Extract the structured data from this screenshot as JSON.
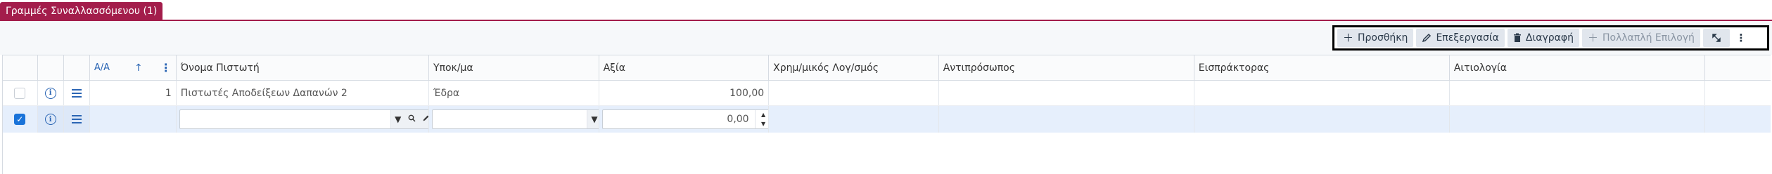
{
  "tab": {
    "label": "Γραμμές Συναλλασσόμενου (1)"
  },
  "toolbar": {
    "add": {
      "icon": "plus-icon",
      "label": "Προσθήκη"
    },
    "edit": {
      "icon": "pencil-icon",
      "label": "Επεξεργασία"
    },
    "delete": {
      "icon": "trash-icon",
      "label": "Διαγραφή"
    },
    "multi": {
      "icon": "plus-icon",
      "label": "Πολλαπλή Επιλογή"
    },
    "expand": {
      "icon": "expand-icon"
    },
    "more": {
      "icon": "kebab-icon"
    }
  },
  "grid": {
    "columns": {
      "aa": "Α/Α",
      "creditor_name": "Όνομα Πιστωτή",
      "branch": "Υποκ/μα",
      "value": "Αξία",
      "fin_account": "Χρημ/μικός Λογ/σμός",
      "representative": "Αντιπρόσωπος",
      "collector": "Εισπράκτορας",
      "reason": "Αιτιολογία"
    },
    "rows": [
      {
        "aa": "1",
        "creditor_name": "Πιστωτές Αποδείξεων Δαπανών 2",
        "branch": "Έδρα",
        "value": "100,00",
        "checked": false
      }
    ],
    "edit_row": {
      "value": "0,00",
      "checked": true
    }
  },
  "colors": {
    "accent": "#a31d4b",
    "link": "#2a65b4",
    "selection": "#e6effc"
  }
}
